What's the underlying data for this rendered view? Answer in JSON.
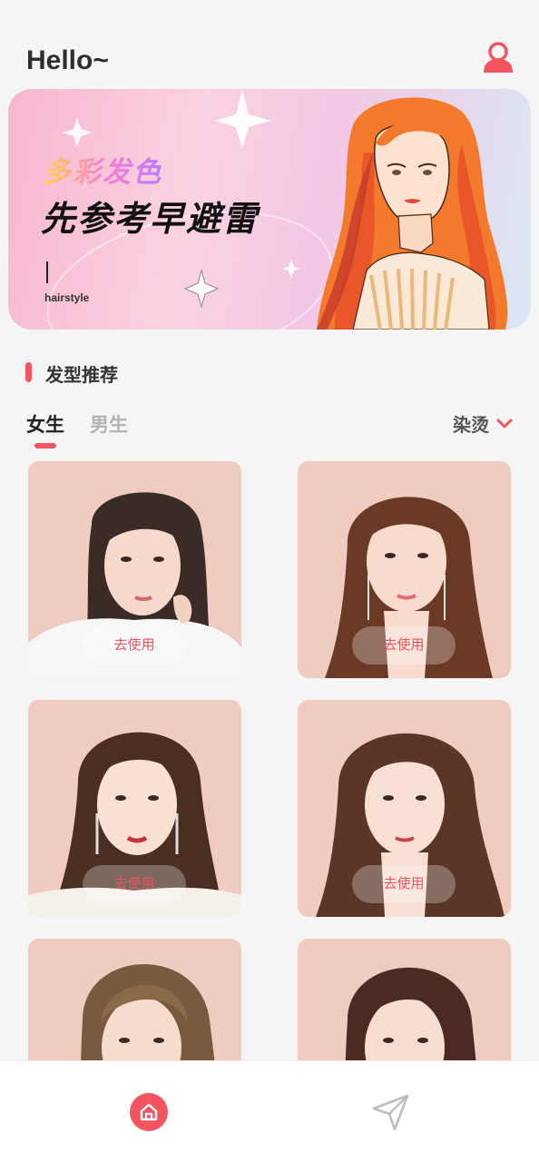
{
  "header": {
    "greeting": "Hello~",
    "profile_icon": "user-profile-icon"
  },
  "banner": {
    "title_line1": "多彩发色",
    "title_line2": "先参考早避雷",
    "subtitle": "hairstyle"
  },
  "section": {
    "title": "发型推荐"
  },
  "tabs": [
    {
      "label": "女生",
      "active": true
    },
    {
      "label": "男生",
      "active": false
    }
  ],
  "filter": {
    "label": "染烫",
    "icon": "chevron-down-icon"
  },
  "cards": [
    {
      "button_label": "去使用"
    },
    {
      "button_label": "去使用"
    },
    {
      "button_label": "去使用"
    },
    {
      "button_label": "去使用"
    },
    {
      "button_label": ""
    },
    {
      "button_label": ""
    }
  ],
  "bottom_nav": [
    {
      "icon": "home-icon",
      "active": true
    },
    {
      "icon": "send-icon",
      "active": false
    }
  ],
  "colors": {
    "accent": "#f2555f",
    "background": "#f5f5f6",
    "card_bg": "#f0cbbf"
  }
}
